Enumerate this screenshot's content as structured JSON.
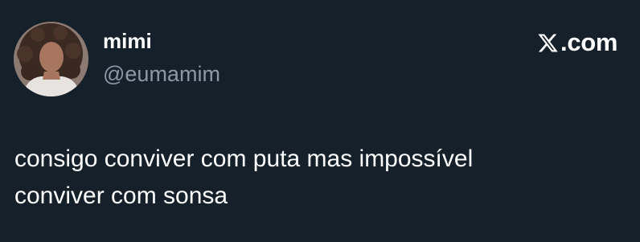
{
  "tweet": {
    "author": {
      "display_name": "mimi",
      "handle": "@eumamim",
      "avatar_icon": "user-avatar"
    },
    "brand": {
      "logo_icon": "x-logo-icon",
      "text": ".com"
    },
    "text": "consigo conviver com puta mas impossível\nconviver com sonsa"
  },
  "colors": {
    "background": "#15202b",
    "primary_text": "#ffffff",
    "secondary_text": "#8b98a5"
  }
}
